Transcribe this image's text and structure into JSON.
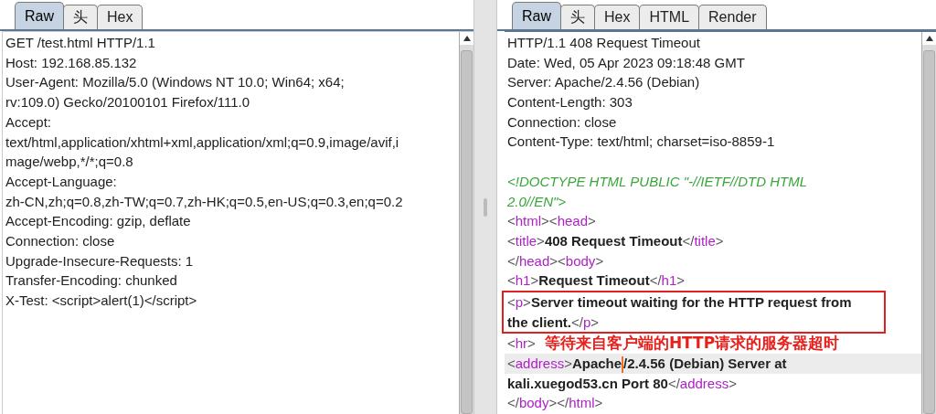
{
  "request": {
    "tabs": [
      {
        "label": "Raw",
        "selected": true
      },
      {
        "label": "头",
        "selected": false
      },
      {
        "label": "Hex",
        "selected": false
      }
    ],
    "lines": [
      "GET /test.html HTTP/1.1",
      "Host: 192.168.85.132",
      "User-Agent: Mozilla/5.0 (Windows NT 10.0; Win64; x64;",
      "rv:109.0) Gecko/20100101 Firefox/111.0",
      "Accept:",
      "text/html,application/xhtml+xml,application/xml;q=0.9,image/avif,i",
      "mage/webp,*/*;q=0.8",
      "Accept-Language:",
      "zh-CN,zh;q=0.8,zh-TW;q=0.7,zh-HK;q=0.5,en-US;q=0.3,en;q=0.2",
      "Accept-Encoding: gzip, deflate",
      "Connection: close",
      "Upgrade-Insecure-Requests: 1",
      "Transfer-Encoding: chunked",
      "X-Test: <script>alert(1)</script>"
    ]
  },
  "response": {
    "tabs": [
      {
        "label": "Raw",
        "selected": true
      },
      {
        "label": "头",
        "selected": false
      },
      {
        "label": "Hex",
        "selected": false
      },
      {
        "label": "HTML",
        "selected": false
      },
      {
        "label": "Render",
        "selected": false
      }
    ],
    "lines": [
      {
        "kind": "normal",
        "segments": [
          {
            "kind": "plain",
            "text": "HTTP/1.1 408 Request Timeout"
          }
        ]
      },
      {
        "kind": "normal",
        "segments": [
          {
            "kind": "plain",
            "text": "Date: Wed, 05 Apr 2023 09:18:48 GMT"
          }
        ]
      },
      {
        "kind": "normal",
        "segments": [
          {
            "kind": "plain",
            "text": "Server: Apache/2.4.56 (Debian)"
          }
        ]
      },
      {
        "kind": "normal",
        "segments": [
          {
            "kind": "plain",
            "text": "Content-Length: 303"
          }
        ]
      },
      {
        "kind": "normal",
        "segments": [
          {
            "kind": "plain",
            "text": "Connection: close"
          }
        ]
      },
      {
        "kind": "normal",
        "segments": [
          {
            "kind": "plain",
            "text": "Content-Type: text/html; charset=iso-8859-1"
          }
        ]
      },
      {
        "kind": "normal"
      },
      {
        "kind": "normal",
        "segments": [
          {
            "kind": "doctype",
            "text": "<!DOCTYPE HTML PUBLIC \"-//IETF//DTD HTML"
          }
        ]
      },
      {
        "kind": "normal",
        "segments": [
          {
            "kind": "doctype",
            "text": "2.0//EN\">"
          }
        ]
      },
      {
        "kind": "normal",
        "segments": [
          {
            "kind": "punct",
            "text": "<"
          },
          {
            "kind": "tag",
            "text": "html"
          },
          {
            "kind": "punct",
            "text": "><"
          },
          {
            "kind": "tag",
            "text": "head"
          },
          {
            "kind": "punct",
            "text": ">"
          }
        ]
      },
      {
        "kind": "normal",
        "segments": [
          {
            "kind": "punct",
            "text": "<"
          },
          {
            "kind": "tag",
            "text": "title"
          },
          {
            "kind": "punct",
            "text": ">"
          },
          {
            "kind": "bold",
            "text": "408 Request Timeout"
          },
          {
            "kind": "punct",
            "text": "</"
          },
          {
            "kind": "tag",
            "text": "title"
          },
          {
            "kind": "punct",
            "text": ">"
          }
        ]
      },
      {
        "kind": "normal",
        "segments": [
          {
            "kind": "punct",
            "text": "</"
          },
          {
            "kind": "tag",
            "text": "head"
          },
          {
            "kind": "punct",
            "text": "><"
          },
          {
            "kind": "tag",
            "text": "body"
          },
          {
            "kind": "punct",
            "text": ">"
          }
        ]
      },
      {
        "kind": "normal",
        "segments": [
          {
            "kind": "punct",
            "text": "<"
          },
          {
            "kind": "tag",
            "text": "h1"
          },
          {
            "kind": "punct",
            "text": ">"
          },
          {
            "kind": "bold",
            "text": "Request Timeout"
          },
          {
            "kind": "punct",
            "text": "</"
          },
          {
            "kind": "tag",
            "text": "h1"
          },
          {
            "kind": "punct",
            "text": ">"
          }
        ]
      },
      {
        "kind": "boxed",
        "segments": [
          {
            "kind": "punct",
            "text": "<"
          },
          {
            "kind": "tag",
            "text": "p"
          },
          {
            "kind": "punct",
            "text": ">"
          },
          {
            "kind": "bold",
            "text": "Server timeout waiting for the HTTP request from"
          }
        ]
      },
      {
        "kind": "boxed",
        "segments": [
          {
            "kind": "bold",
            "text": "the client."
          },
          {
            "kind": "punct",
            "text": "</"
          },
          {
            "kind": "tag",
            "text": "p"
          },
          {
            "kind": "punct",
            "text": ">"
          }
        ]
      },
      {
        "kind": "normal",
        "segments": [
          {
            "kind": "punct",
            "text": "<"
          },
          {
            "kind": "tag",
            "text": "hr"
          },
          {
            "kind": "punct",
            "text": ">"
          },
          {
            "kind": "note",
            "text": "等待来自客户端的HTTP请求的服务器超时"
          }
        ]
      },
      {
        "kind": "current",
        "segments": [
          {
            "kind": "punct",
            "text": "<"
          },
          {
            "kind": "tag",
            "text": "address"
          },
          {
            "kind": "punct",
            "text": ">"
          },
          {
            "kind": "bold",
            "text": "Apache"
          },
          {
            "kind": "caret"
          },
          {
            "kind": "bold",
            "text": "/2.4.56 (Debian) Server at"
          }
        ]
      },
      {
        "kind": "normal",
        "segments": [
          {
            "kind": "bold",
            "text": "kali.xuegod53.cn Port 80"
          },
          {
            "kind": "punct",
            "text": "</"
          },
          {
            "kind": "tag",
            "text": "address"
          },
          {
            "kind": "punct",
            "text": ">"
          }
        ]
      },
      {
        "kind": "normal",
        "segments": [
          {
            "kind": "punct",
            "text": "</"
          },
          {
            "kind": "tag",
            "text": "body"
          },
          {
            "kind": "punct",
            "text": "></"
          },
          {
            "kind": "tag",
            "text": "html"
          },
          {
            "kind": "punct",
            "text": ">"
          }
        ]
      }
    ]
  }
}
